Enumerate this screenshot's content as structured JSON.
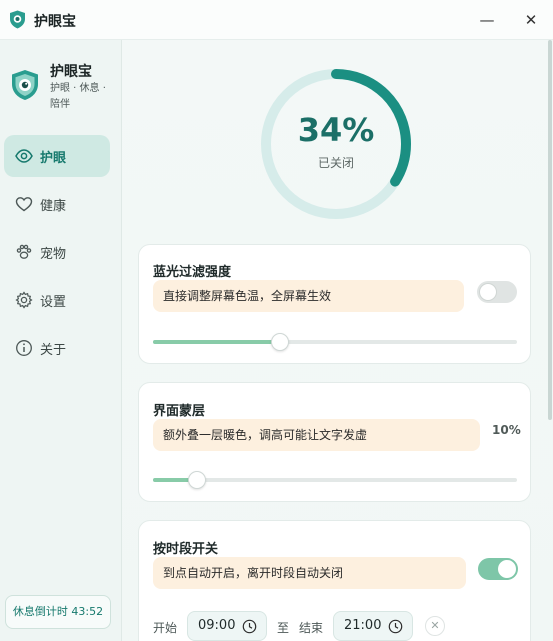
{
  "window": {
    "title": "护眼宝",
    "minimize_glyph": "—",
    "close_glyph": "✕"
  },
  "sidebar": {
    "brand": {
      "name": "护眼宝",
      "subtitle": "护眼 · 休息 · 陪伴"
    },
    "items": [
      {
        "label": "护眼",
        "icon": "eye-icon",
        "active": true
      },
      {
        "label": "健康",
        "icon": "heart-icon",
        "active": false
      },
      {
        "label": "宠物",
        "icon": "paw-icon",
        "active": false
      },
      {
        "label": "设置",
        "icon": "gear-icon",
        "active": false
      },
      {
        "label": "关于",
        "icon": "info-icon",
        "active": false
      }
    ],
    "countdown": "休息倒计时 43:52"
  },
  "main": {
    "ring": {
      "value_text": "34%",
      "progress": 0.34,
      "caption": "已关闭"
    },
    "blue_light": {
      "title": "蓝光过滤强度",
      "note": "直接调整屏幕色温，全屏幕生效",
      "toggle_on": false,
      "slider_value": 0.35
    },
    "overlay": {
      "title": "界面蒙层",
      "note": "额外叠一层暖色，调高可能让文字发虚",
      "percent": "10%",
      "slider_value": 0.12
    },
    "schedule": {
      "title": "按时段开关",
      "note": "到点自动开启，离开时段自动关闭",
      "toggle_on": true,
      "start_label": "开始",
      "start_time": "09:00",
      "to_label": "至",
      "end_label": "结束",
      "end_time": "21:00",
      "clear_glyph": "✕"
    }
  },
  "colors": {
    "accent": "#1b8f82",
    "ring_track": "#d6ecea",
    "note_bg": "#fdf0df",
    "slider_fill": "#88cba8",
    "toggle_on": "#7ec6a8"
  }
}
